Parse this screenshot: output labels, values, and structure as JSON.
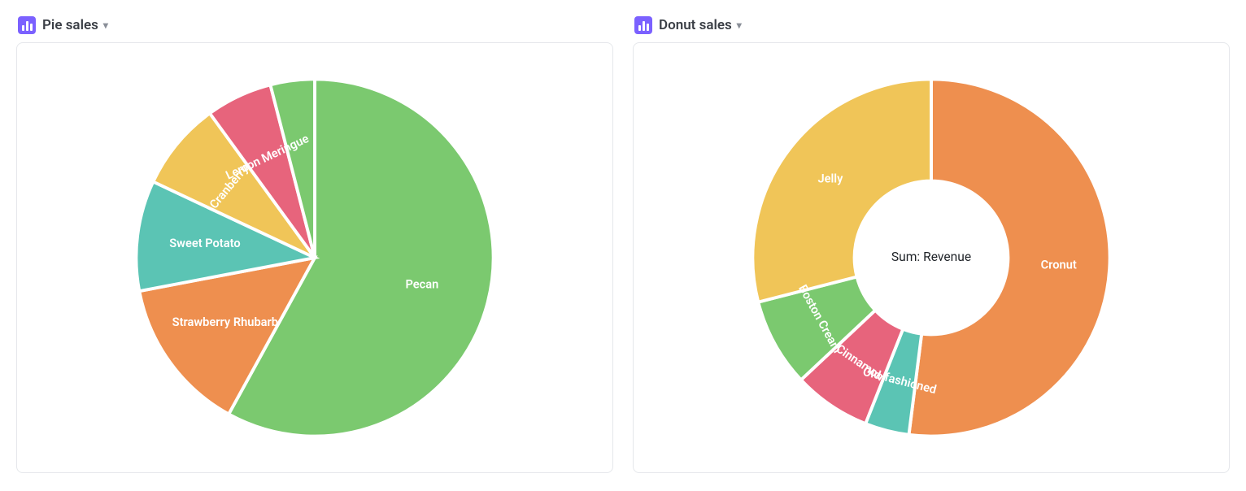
{
  "panels": [
    {
      "id": "pie",
      "title": "Pie sales"
    },
    {
      "id": "donut",
      "title": "Donut sales"
    }
  ],
  "colors": {
    "green": "#7bc96f",
    "orange": "#ee8f4f",
    "teal": "#5bc4b4",
    "yellow": "#f0c558",
    "pink": "#e7647c"
  },
  "chart_data": [
    {
      "id": "pie",
      "type": "pie",
      "title": "Pie sales",
      "center_label": "",
      "inner_radius": 0,
      "series": [
        {
          "name": "Pecan",
          "value": 58,
          "color": "green"
        },
        {
          "name": "Strawberry Rhubarb",
          "value": 14,
          "color": "orange"
        },
        {
          "name": "Sweet Potato",
          "value": 10,
          "color": "teal"
        },
        {
          "name": "Cranberry",
          "value": 8,
          "color": "yellow"
        },
        {
          "name": "Lemon Meringue",
          "value": 6,
          "color": "pink"
        },
        {
          "name": "_unlabeled",
          "value": 4,
          "color": "green",
          "hide_label": true
        }
      ]
    },
    {
      "id": "donut",
      "type": "pie",
      "title": "Donut sales",
      "center_label": "Sum: Revenue",
      "inner_radius": 0.43,
      "series": [
        {
          "name": "Cronut",
          "value": 52,
          "color": "orange"
        },
        {
          "name": "Old-fashioned",
          "value": 4,
          "color": "teal"
        },
        {
          "name": "Cinnamon",
          "value": 7,
          "color": "pink"
        },
        {
          "name": "Boston Cream",
          "value": 8,
          "color": "green"
        },
        {
          "name": "Jelly",
          "value": 29,
          "color": "yellow"
        }
      ]
    }
  ]
}
